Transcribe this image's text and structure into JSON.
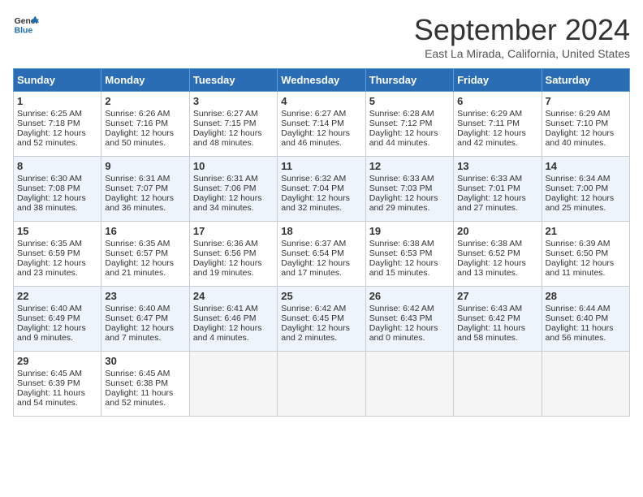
{
  "logo": {
    "line1": "General",
    "line2": "Blue"
  },
  "title": "September 2024",
  "location": "East La Mirada, California, United States",
  "days_of_week": [
    "Sunday",
    "Monday",
    "Tuesday",
    "Wednesday",
    "Thursday",
    "Friday",
    "Saturday"
  ],
  "weeks": [
    [
      {
        "day": 1,
        "sunrise": "6:25 AM",
        "sunset": "7:18 PM",
        "daylight": "12 hours and 52 minutes."
      },
      {
        "day": 2,
        "sunrise": "6:26 AM",
        "sunset": "7:16 PM",
        "daylight": "12 hours and 50 minutes."
      },
      {
        "day": 3,
        "sunrise": "6:27 AM",
        "sunset": "7:15 PM",
        "daylight": "12 hours and 48 minutes."
      },
      {
        "day": 4,
        "sunrise": "6:27 AM",
        "sunset": "7:14 PM",
        "daylight": "12 hours and 46 minutes."
      },
      {
        "day": 5,
        "sunrise": "6:28 AM",
        "sunset": "7:12 PM",
        "daylight": "12 hours and 44 minutes."
      },
      {
        "day": 6,
        "sunrise": "6:29 AM",
        "sunset": "7:11 PM",
        "daylight": "12 hours and 42 minutes."
      },
      {
        "day": 7,
        "sunrise": "6:29 AM",
        "sunset": "7:10 PM",
        "daylight": "12 hours and 40 minutes."
      }
    ],
    [
      {
        "day": 8,
        "sunrise": "6:30 AM",
        "sunset": "7:08 PM",
        "daylight": "12 hours and 38 minutes."
      },
      {
        "day": 9,
        "sunrise": "6:31 AM",
        "sunset": "7:07 PM",
        "daylight": "12 hours and 36 minutes."
      },
      {
        "day": 10,
        "sunrise": "6:31 AM",
        "sunset": "7:06 PM",
        "daylight": "12 hours and 34 minutes."
      },
      {
        "day": 11,
        "sunrise": "6:32 AM",
        "sunset": "7:04 PM",
        "daylight": "12 hours and 32 minutes."
      },
      {
        "day": 12,
        "sunrise": "6:33 AM",
        "sunset": "7:03 PM",
        "daylight": "12 hours and 29 minutes."
      },
      {
        "day": 13,
        "sunrise": "6:33 AM",
        "sunset": "7:01 PM",
        "daylight": "12 hours and 27 minutes."
      },
      {
        "day": 14,
        "sunrise": "6:34 AM",
        "sunset": "7:00 PM",
        "daylight": "12 hours and 25 minutes."
      }
    ],
    [
      {
        "day": 15,
        "sunrise": "6:35 AM",
        "sunset": "6:59 PM",
        "daylight": "12 hours and 23 minutes."
      },
      {
        "day": 16,
        "sunrise": "6:35 AM",
        "sunset": "6:57 PM",
        "daylight": "12 hours and 21 minutes."
      },
      {
        "day": 17,
        "sunrise": "6:36 AM",
        "sunset": "6:56 PM",
        "daylight": "12 hours and 19 minutes."
      },
      {
        "day": 18,
        "sunrise": "6:37 AM",
        "sunset": "6:54 PM",
        "daylight": "12 hours and 17 minutes."
      },
      {
        "day": 19,
        "sunrise": "6:38 AM",
        "sunset": "6:53 PM",
        "daylight": "12 hours and 15 minutes."
      },
      {
        "day": 20,
        "sunrise": "6:38 AM",
        "sunset": "6:52 PM",
        "daylight": "12 hours and 13 minutes."
      },
      {
        "day": 21,
        "sunrise": "6:39 AM",
        "sunset": "6:50 PM",
        "daylight": "12 hours and 11 minutes."
      }
    ],
    [
      {
        "day": 22,
        "sunrise": "6:40 AM",
        "sunset": "6:49 PM",
        "daylight": "12 hours and 9 minutes."
      },
      {
        "day": 23,
        "sunrise": "6:40 AM",
        "sunset": "6:47 PM",
        "daylight": "12 hours and 7 minutes."
      },
      {
        "day": 24,
        "sunrise": "6:41 AM",
        "sunset": "6:46 PM",
        "daylight": "12 hours and 4 minutes."
      },
      {
        "day": 25,
        "sunrise": "6:42 AM",
        "sunset": "6:45 PM",
        "daylight": "12 hours and 2 minutes."
      },
      {
        "day": 26,
        "sunrise": "6:42 AM",
        "sunset": "6:43 PM",
        "daylight": "12 hours and 0 minutes."
      },
      {
        "day": 27,
        "sunrise": "6:43 AM",
        "sunset": "6:42 PM",
        "daylight": "11 hours and 58 minutes."
      },
      {
        "day": 28,
        "sunrise": "6:44 AM",
        "sunset": "6:40 PM",
        "daylight": "11 hours and 56 minutes."
      }
    ],
    [
      {
        "day": 29,
        "sunrise": "6:45 AM",
        "sunset": "6:39 PM",
        "daylight": "11 hours and 54 minutes."
      },
      {
        "day": 30,
        "sunrise": "6:45 AM",
        "sunset": "6:38 PM",
        "daylight": "11 hours and 52 minutes."
      },
      null,
      null,
      null,
      null,
      null
    ]
  ]
}
